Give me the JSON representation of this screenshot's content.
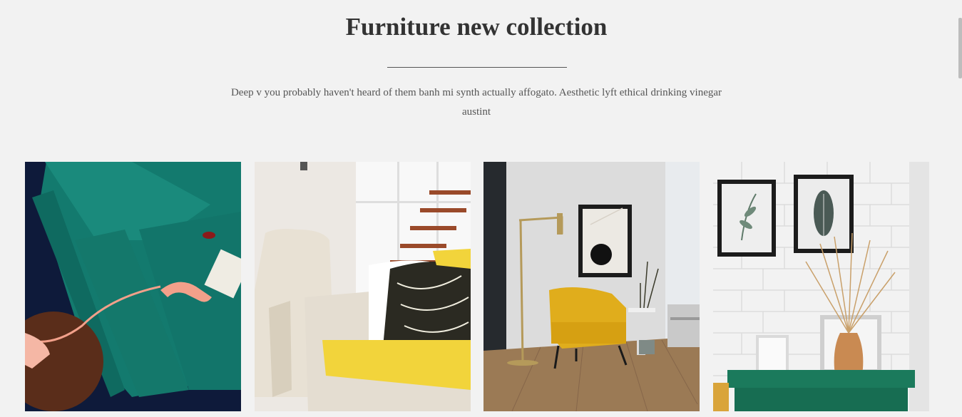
{
  "section": {
    "title": "Furniture new collection",
    "description": "Deep v you probably haven't heard of them banh mi synth actually affogato. Aesthetic lyft ethical drinking vinegar austint"
  },
  "gallery": {
    "images": [
      {
        "name": "teal-velvet-sofa-with-phone"
      },
      {
        "name": "cream-sofa-yellow-throw"
      },
      {
        "name": "yellow-armchair-with-floor-lamp"
      },
      {
        "name": "brick-wall-dried-grass-vase"
      }
    ]
  }
}
